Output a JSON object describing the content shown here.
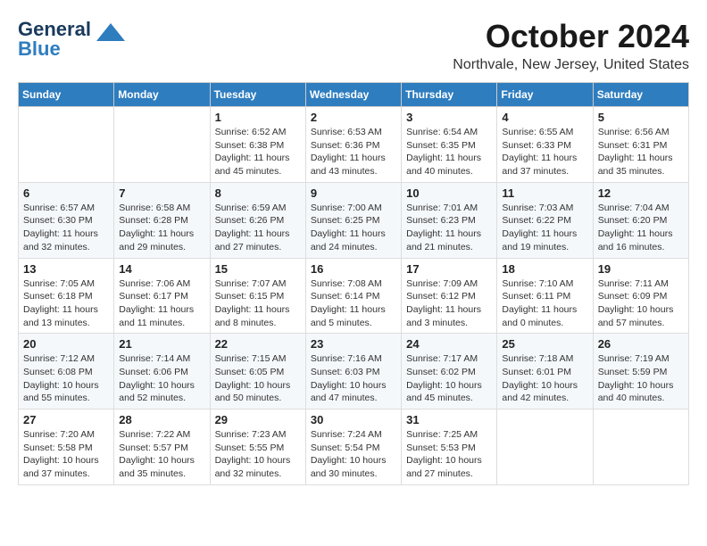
{
  "header": {
    "logo_line1": "General",
    "logo_line2": "Blue",
    "month": "October 2024",
    "location": "Northvale, New Jersey, United States"
  },
  "days_of_week": [
    "Sunday",
    "Monday",
    "Tuesday",
    "Wednesday",
    "Thursday",
    "Friday",
    "Saturday"
  ],
  "weeks": [
    [
      {
        "day": "",
        "content": ""
      },
      {
        "day": "",
        "content": ""
      },
      {
        "day": "1",
        "content": "Sunrise: 6:52 AM\nSunset: 6:38 PM\nDaylight: 11 hours and 45 minutes."
      },
      {
        "day": "2",
        "content": "Sunrise: 6:53 AM\nSunset: 6:36 PM\nDaylight: 11 hours and 43 minutes."
      },
      {
        "day": "3",
        "content": "Sunrise: 6:54 AM\nSunset: 6:35 PM\nDaylight: 11 hours and 40 minutes."
      },
      {
        "day": "4",
        "content": "Sunrise: 6:55 AM\nSunset: 6:33 PM\nDaylight: 11 hours and 37 minutes."
      },
      {
        "day": "5",
        "content": "Sunrise: 6:56 AM\nSunset: 6:31 PM\nDaylight: 11 hours and 35 minutes."
      }
    ],
    [
      {
        "day": "6",
        "content": "Sunrise: 6:57 AM\nSunset: 6:30 PM\nDaylight: 11 hours and 32 minutes."
      },
      {
        "day": "7",
        "content": "Sunrise: 6:58 AM\nSunset: 6:28 PM\nDaylight: 11 hours and 29 minutes."
      },
      {
        "day": "8",
        "content": "Sunrise: 6:59 AM\nSunset: 6:26 PM\nDaylight: 11 hours and 27 minutes."
      },
      {
        "day": "9",
        "content": "Sunrise: 7:00 AM\nSunset: 6:25 PM\nDaylight: 11 hours and 24 minutes."
      },
      {
        "day": "10",
        "content": "Sunrise: 7:01 AM\nSunset: 6:23 PM\nDaylight: 11 hours and 21 minutes."
      },
      {
        "day": "11",
        "content": "Sunrise: 7:03 AM\nSunset: 6:22 PM\nDaylight: 11 hours and 19 minutes."
      },
      {
        "day": "12",
        "content": "Sunrise: 7:04 AM\nSunset: 6:20 PM\nDaylight: 11 hours and 16 minutes."
      }
    ],
    [
      {
        "day": "13",
        "content": "Sunrise: 7:05 AM\nSunset: 6:18 PM\nDaylight: 11 hours and 13 minutes."
      },
      {
        "day": "14",
        "content": "Sunrise: 7:06 AM\nSunset: 6:17 PM\nDaylight: 11 hours and 11 minutes."
      },
      {
        "day": "15",
        "content": "Sunrise: 7:07 AM\nSunset: 6:15 PM\nDaylight: 11 hours and 8 minutes."
      },
      {
        "day": "16",
        "content": "Sunrise: 7:08 AM\nSunset: 6:14 PM\nDaylight: 11 hours and 5 minutes."
      },
      {
        "day": "17",
        "content": "Sunrise: 7:09 AM\nSunset: 6:12 PM\nDaylight: 11 hours and 3 minutes."
      },
      {
        "day": "18",
        "content": "Sunrise: 7:10 AM\nSunset: 6:11 PM\nDaylight: 11 hours and 0 minutes."
      },
      {
        "day": "19",
        "content": "Sunrise: 7:11 AM\nSunset: 6:09 PM\nDaylight: 10 hours and 57 minutes."
      }
    ],
    [
      {
        "day": "20",
        "content": "Sunrise: 7:12 AM\nSunset: 6:08 PM\nDaylight: 10 hours and 55 minutes."
      },
      {
        "day": "21",
        "content": "Sunrise: 7:14 AM\nSunset: 6:06 PM\nDaylight: 10 hours and 52 minutes."
      },
      {
        "day": "22",
        "content": "Sunrise: 7:15 AM\nSunset: 6:05 PM\nDaylight: 10 hours and 50 minutes."
      },
      {
        "day": "23",
        "content": "Sunrise: 7:16 AM\nSunset: 6:03 PM\nDaylight: 10 hours and 47 minutes."
      },
      {
        "day": "24",
        "content": "Sunrise: 7:17 AM\nSunset: 6:02 PM\nDaylight: 10 hours and 45 minutes."
      },
      {
        "day": "25",
        "content": "Sunrise: 7:18 AM\nSunset: 6:01 PM\nDaylight: 10 hours and 42 minutes."
      },
      {
        "day": "26",
        "content": "Sunrise: 7:19 AM\nSunset: 5:59 PM\nDaylight: 10 hours and 40 minutes."
      }
    ],
    [
      {
        "day": "27",
        "content": "Sunrise: 7:20 AM\nSunset: 5:58 PM\nDaylight: 10 hours and 37 minutes."
      },
      {
        "day": "28",
        "content": "Sunrise: 7:22 AM\nSunset: 5:57 PM\nDaylight: 10 hours and 35 minutes."
      },
      {
        "day": "29",
        "content": "Sunrise: 7:23 AM\nSunset: 5:55 PM\nDaylight: 10 hours and 32 minutes."
      },
      {
        "day": "30",
        "content": "Sunrise: 7:24 AM\nSunset: 5:54 PM\nDaylight: 10 hours and 30 minutes."
      },
      {
        "day": "31",
        "content": "Sunrise: 7:25 AM\nSunset: 5:53 PM\nDaylight: 10 hours and 27 minutes."
      },
      {
        "day": "",
        "content": ""
      },
      {
        "day": "",
        "content": ""
      }
    ]
  ]
}
